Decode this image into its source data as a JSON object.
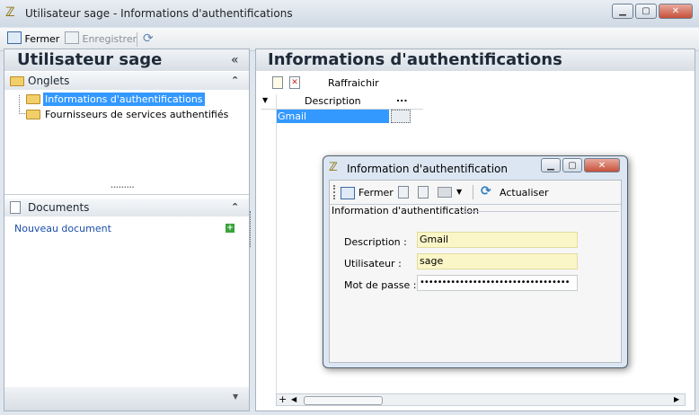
{
  "window": {
    "title": "Utilisateur sage -  Informations d'authentifications"
  },
  "toolbar": {
    "close_label": "Fermer",
    "save_label": "Enregistrer"
  },
  "left": {
    "header": "Utilisateur sage",
    "collapse_glyph": "«",
    "onglets": {
      "label": "Onglets",
      "items": [
        "Informations d'authentifications",
        "Fournisseurs de services authentifiés"
      ]
    },
    "documents": {
      "label": "Documents",
      "new_link": "Nouveau document"
    },
    "splitter_dots": "•••••••••"
  },
  "right": {
    "header": "Informations d'authentifications",
    "refresh_label": "Raffraichir",
    "grid": {
      "column": "Description",
      "ellipsis": "...",
      "rows": [
        "Gmail"
      ]
    }
  },
  "dialog": {
    "title": "Information d'authentification",
    "toolbar": {
      "close_label": "Fermer",
      "refresh_label": "Actualiser"
    },
    "group_label": "Information d'authentification",
    "fields": {
      "description": {
        "label": "Description :",
        "value": "Gmail"
      },
      "user": {
        "label": "Utilisateur :",
        "value": "sage"
      },
      "password": {
        "label": "Mot de passe :",
        "value": "••••••••••••••••••••••••••••••••••"
      }
    }
  },
  "icons": {
    "app": "app-logo-icon",
    "close": "close-icon",
    "save": "save-icon",
    "refresh": "refresh-icon"
  }
}
